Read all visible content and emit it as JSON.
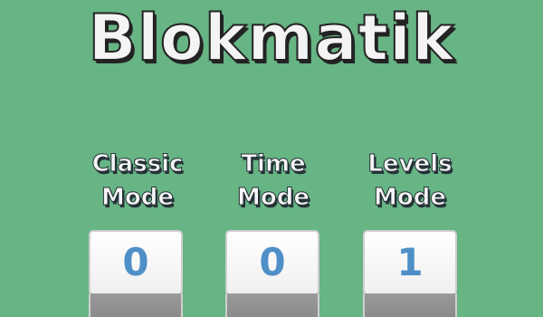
{
  "game": {
    "title": "Blokmatik"
  },
  "modes": [
    {
      "line1": "Classic",
      "line2": "Mode",
      "score": "0"
    },
    {
      "line1": "Time",
      "line2": "Mode",
      "score": "0"
    },
    {
      "line1": "Levels",
      "line2": "Mode",
      "score": "1"
    }
  ],
  "colors": {
    "background": "#67b484",
    "score_text": "#4f8fc8",
    "tile_face": "#ffffff",
    "tile_side": "#8f8f8f"
  }
}
